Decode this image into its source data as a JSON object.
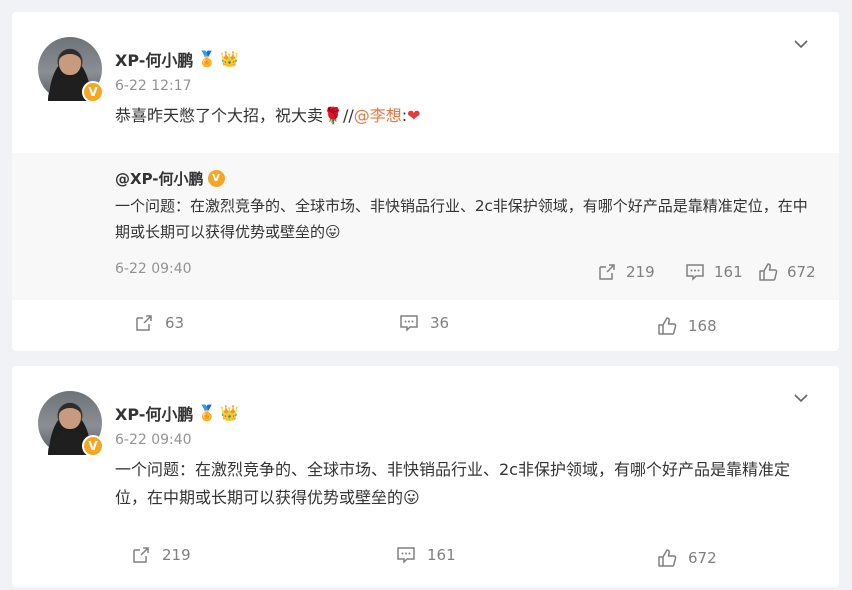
{
  "posts": [
    {
      "author": "XP-何小鹏",
      "time": "6-22 12:17",
      "text_main": "恭喜昨天憋了个大招，祝大卖",
      "text_sep": "//",
      "mention": "@李想",
      "text_colon": ":",
      "quoted": {
        "user": "@XP-何小鹏",
        "text": "一个问题：在激烈竞争的、全球市场、非快销品行业、2c非保护领域，有哪个好产品是靠精准定位，在中期或长期可以获得优势或壁垒的",
        "time": "6-22 09:40",
        "reposts": "219",
        "comments": "161",
        "likes": "672"
      },
      "reposts": "63",
      "comments": "36",
      "likes": "168"
    },
    {
      "author": "XP-何小鹏",
      "time": "6-22 09:40",
      "text": "一个问题：在激烈竞争的、全球市场、非快销品行业、2c非保护领域，有哪个好产品是靠精准定位，在中期或长期可以获得优势或壁垒的",
      "reposts": "219",
      "comments": "161",
      "likes": "672"
    }
  ],
  "icons": {
    "verified": "V",
    "medal": "🏅",
    "crown": "👑",
    "rose": "🌹",
    "heart": "❤",
    "tongue": "😛"
  },
  "colors": {
    "background": "#f1f2f5",
    "card": "#ffffff",
    "quote_bg": "#f8f8f8",
    "mention": "#eb7340",
    "meta": "#939393",
    "verified": "#f5a623"
  }
}
